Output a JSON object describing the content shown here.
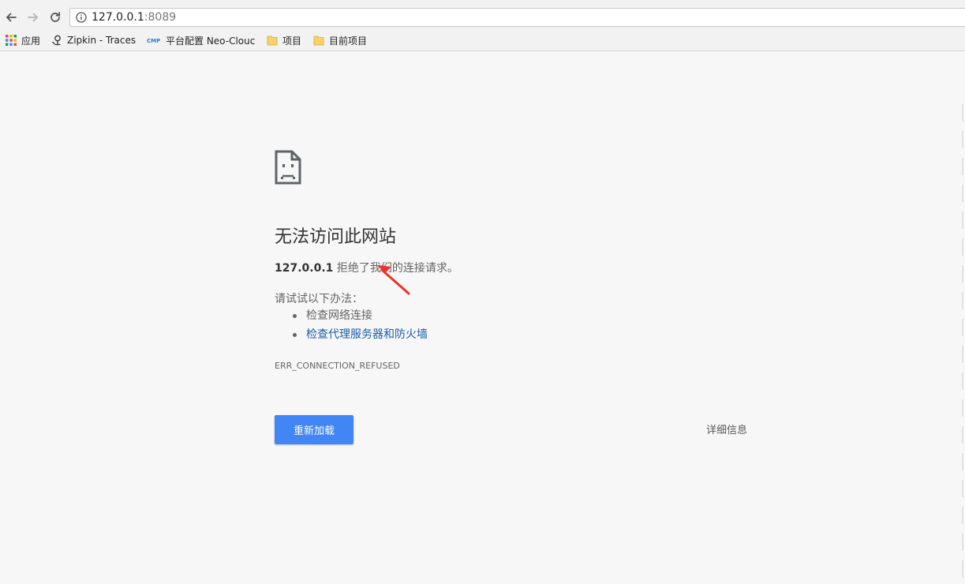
{
  "toolbar": {
    "url_host": "127.0.0.1",
    "url_port": ":8089"
  },
  "bookmarks": [
    {
      "label": "应用",
      "icon": "apps-grid-icon"
    },
    {
      "label": "Zipkin - Traces",
      "icon": "zipkin-icon"
    },
    {
      "label": "平台配置 Neo-Clouc",
      "icon": "cmp-icon"
    },
    {
      "label": "项目",
      "icon": "folder-icon"
    },
    {
      "label": "目前项目",
      "icon": "folder-icon"
    }
  ],
  "error": {
    "heading": "无法访问此网站",
    "host": "127.0.0.1",
    "description_suffix": " 拒绝了我们的连接请求。",
    "try_label": "请试试以下办法：",
    "suggestions": [
      "检查网络连接",
      "检查代理服务器和防火墙"
    ],
    "code": "ERR_CONNECTION_REFUSED",
    "reload_label": "重新加载",
    "details_label": "详细信息"
  },
  "colors": {
    "accent": "#4285f4",
    "link": "#1a5fa8",
    "annotation_arrow": "#e8342b",
    "background": "#f7f7f7"
  }
}
